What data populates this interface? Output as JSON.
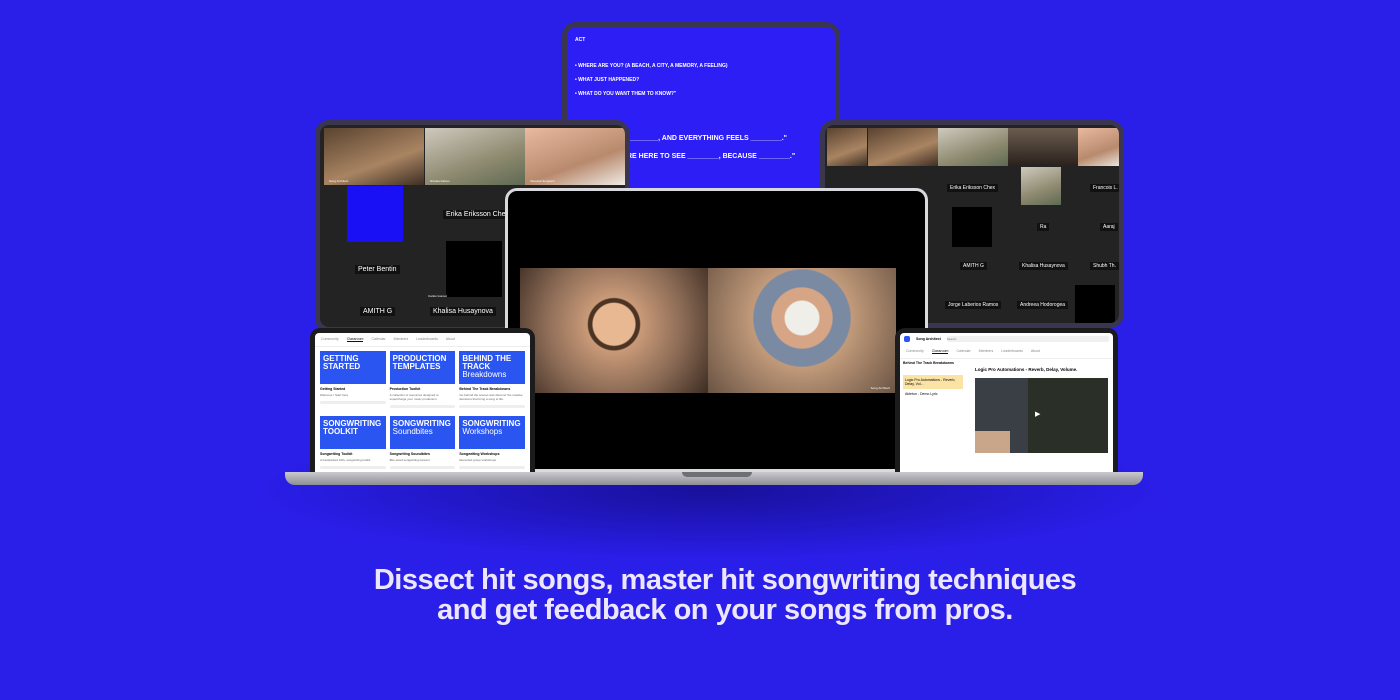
{
  "headline": {
    "line1": "Dissect hit songs, master hit songwriting techniques",
    "line2": "and get feedback on your songs from pros."
  },
  "prompt_slide": {
    "tag": "ACT",
    "questions": [
      "WHERE ARE YOU? (A BEACH, A CITY, A MEMORY, A FEELING)",
      "WHAT JUST HAPPENED?",
      "WHAT DO YOU WANT THEM TO KNOW?\""
    ],
    "fill_lines": [
      "________, AND EVERYTHING FEELS ________.\"",
      "RE HERE TO SEE ________, BECAUSE ________.\""
    ]
  },
  "left_call": {
    "participants": [
      "Song Architect",
      "Nicolas Falcon",
      "Vanessa Sergeant",
      "Erika Eriksson Chex",
      "Peter Bentin",
      "AMITH G",
      "Carlos Gomez",
      "Khalisa Husaynova"
    ]
  },
  "right_call": {
    "participants": [
      "Erika Eriksson Chex",
      "Francois L.",
      "Ra",
      "Aaraj",
      "AMITH G",
      "Khalisa Husaynova",
      "Shubh Th.",
      "Jorge Laberios Ramos",
      "Andreea Hodorogea"
    ]
  },
  "main_video": {
    "label": "Song Architect"
  },
  "courses_app": {
    "tabs": [
      "Community",
      "Classroom",
      "Calendar",
      "Members",
      "Leaderboards",
      "About"
    ],
    "active_tab": "Classroom",
    "cards": [
      {
        "banner": "GETTING STARTED",
        "sub": "",
        "title": "Getting Started",
        "desc": "Welcome / Start here"
      },
      {
        "banner": "PRODUCTION TEMPLATES",
        "sub": "",
        "title": "Production Toolkit",
        "desc": "A collection of resources designed to supercharge your music production."
      },
      {
        "banner": "BEHIND THE TRACK",
        "sub": "Breakdowns",
        "title": "Behind The Track Breakdowns",
        "desc": "Go behind the scenes and discover the creative decisions that bring a song to life."
      },
      {
        "banner": "SONGWRITING TOOLKIT",
        "sub": "",
        "title": "Songwriting Toolkit",
        "desc": "A handpicked 100+ songwriting toolkit"
      },
      {
        "banner": "SONGWRITING",
        "sub": "Soundbites",
        "title": "Songwriting Soundbites",
        "desc": "Bite-sized songwriting lessons"
      },
      {
        "banner": "SONGWRITING",
        "sub": "Workshops",
        "title": "Songwriting Workshops",
        "desc": "Recorded group workshops"
      }
    ]
  },
  "lesson_app": {
    "group": "Song Architect",
    "search_placeholder": "Search",
    "tabs": [
      "Community",
      "Classroom",
      "Calendar",
      "Members",
      "Leaderboards",
      "About"
    ],
    "active_tab": "Classroom",
    "module": "Behind The Track Breakdowns",
    "lessons": [
      "Logic Pro Automations - Reverb, Delay, Vol...",
      "Ableton - Demo Lyric"
    ],
    "lesson_title": "Logic Pro Automations - Reverb, Delay, Volume."
  }
}
